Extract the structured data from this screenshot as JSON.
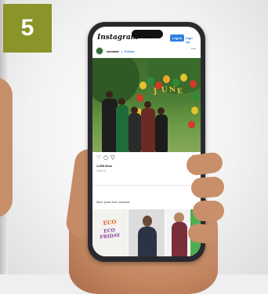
{
  "badge": {
    "number": "5"
  },
  "instagram": {
    "logo": "Instagram",
    "login_label": "Log In",
    "signup_label": "Sign Up",
    "account": "sacstate",
    "follow_label": "Follow",
    "more_icon": "more-dots-icon",
    "likes": "1,099 likes",
    "date": "June 14",
    "more_posts": "More posts from sacstate",
    "grid_tiles": [
      {
        "caption": "ECO FRIDAY"
      },
      {
        "caption": ""
      },
      {
        "caption": ""
      }
    ],
    "action_icons": [
      "heart-icon",
      "comment-icon",
      "share-icon",
      "bookmark-icon"
    ]
  },
  "colors": {
    "badge": "#8a9428",
    "brand_blue": "#2f7fe0",
    "phone_frame": "#2a2a2e"
  }
}
